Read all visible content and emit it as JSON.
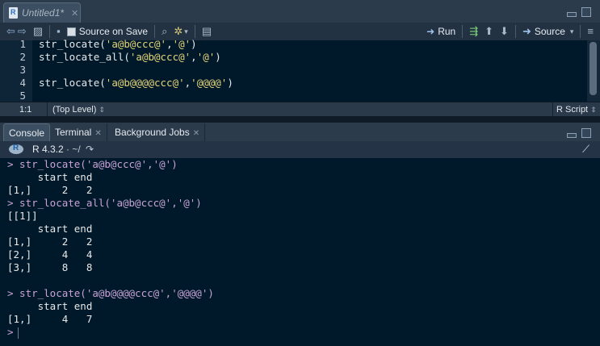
{
  "editor": {
    "tab_title": "Untitled1*",
    "close": "✕",
    "toolbar": {
      "source_on_save": "Source on Save",
      "run": "Run",
      "source": "Source"
    },
    "lines": [
      {
        "num": "1",
        "parts": [
          [
            "str_locate(",
            ""
          ],
          [
            "'a@b@ccc@'",
            "str"
          ],
          [
            ",",
            ""
          ],
          [
            "'@'",
            "str"
          ],
          [
            ")",
            ""
          ]
        ]
      },
      {
        "num": "2",
        "parts": [
          [
            "str_locate_all(",
            ""
          ],
          [
            "'a@b@ccc@'",
            "str"
          ],
          [
            ",",
            ""
          ],
          [
            "'@'",
            "str"
          ],
          [
            ")",
            ""
          ]
        ]
      },
      {
        "num": "3",
        "parts": []
      },
      {
        "num": "4",
        "parts": [
          [
            "str_locate(",
            ""
          ],
          [
            "'a@b@@@@ccc@'",
            "str"
          ],
          [
            ",",
            ""
          ],
          [
            "'@@@@'",
            "str"
          ],
          [
            ")",
            ""
          ]
        ]
      },
      {
        "num": "5",
        "parts": []
      }
    ],
    "status": {
      "position": "1:1",
      "scope": "(Top Level)",
      "file_type": "R Script"
    }
  },
  "console": {
    "tabs": [
      {
        "label": "Console"
      },
      {
        "label": "Terminal"
      },
      {
        "label": "Background Jobs"
      }
    ],
    "r_version": "R 4.3.2",
    "path": "· ~/",
    "output": [
      {
        "text": "> str_locate('a@b@ccc@','@')",
        "kind": "cmd"
      },
      {
        "text": "     start end",
        "kind": "out"
      },
      {
        "text": "[1,]     2   2",
        "kind": "out"
      },
      {
        "text": "> str_locate_all('a@b@ccc@','@')",
        "kind": "cmd"
      },
      {
        "text": "[[1]]",
        "kind": "out"
      },
      {
        "text": "     start end",
        "kind": "out"
      },
      {
        "text": "[1,]     2   2",
        "kind": "out"
      },
      {
        "text": "[2,]     4   4",
        "kind": "out"
      },
      {
        "text": "[3,]     8   8",
        "kind": "out"
      },
      {
        "text": "",
        "kind": "out"
      },
      {
        "text": "> str_locate('a@b@@@@ccc@','@@@@')",
        "kind": "cmd"
      },
      {
        "text": "     start end",
        "kind": "out"
      },
      {
        "text": "[1,]     4   7",
        "kind": "out"
      }
    ],
    "prompt": ">"
  }
}
